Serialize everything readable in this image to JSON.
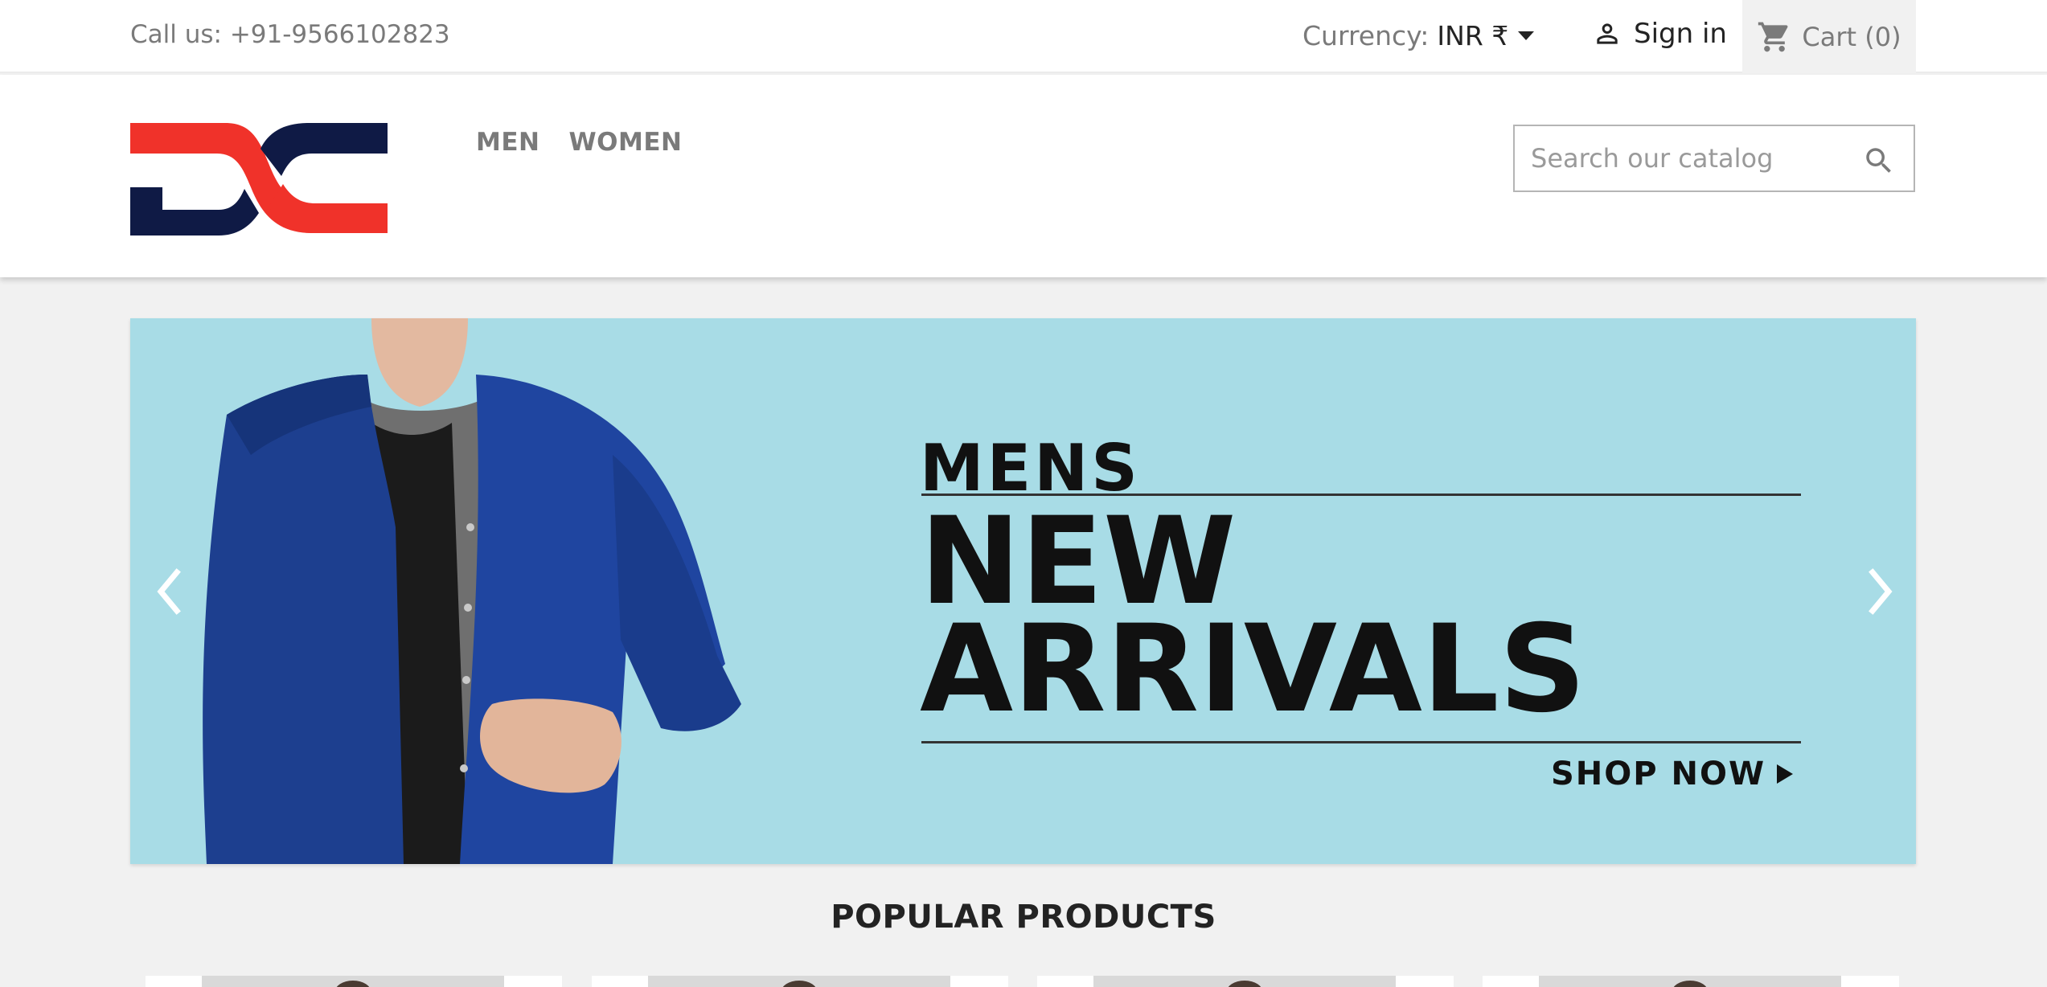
{
  "topbar": {
    "call": "Call us: +91-9566102823",
    "currency_label": "Currency:",
    "currency_value": "INR ₹",
    "signin": "Sign in",
    "cart": "Cart (0)"
  },
  "header": {
    "nav": [
      "MEN",
      "WOMEN"
    ],
    "search_placeholder": "Search our catalog"
  },
  "banner": {
    "line1": "MENS",
    "line2": "NEW",
    "line3": "ARRIVALS",
    "cta": "SHOP NOW"
  },
  "section": {
    "title": "POPULAR PRODUCTS"
  },
  "colors": {
    "logo_red": "#f0322a",
    "logo_navy": "#0f1a45",
    "banner_bg": "#a8dce6"
  },
  "icons": [
    "person-icon",
    "cart-icon",
    "search-icon",
    "chevron-left-icon",
    "chevron-right-icon"
  ]
}
